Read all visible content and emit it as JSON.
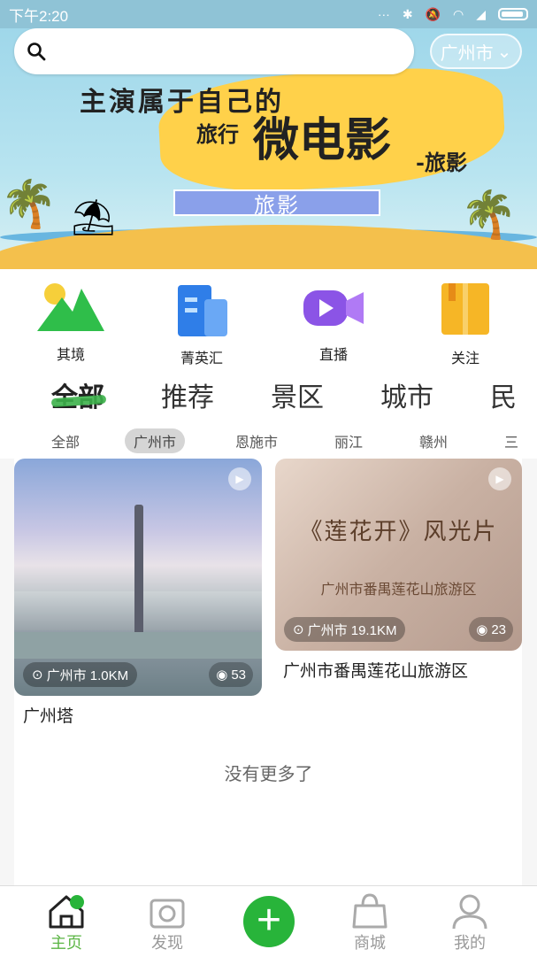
{
  "status_bar": {
    "time": "下午2:20",
    "icons": [
      "signal-dots-icon",
      "bluetooth-icon",
      "mute-icon",
      "wifi-icon",
      "signal-icon",
      "battery-icon"
    ]
  },
  "search": {
    "placeholder": "",
    "value": ""
  },
  "city_selector": {
    "label": "广州市"
  },
  "banner": {
    "line1": "主演属于自己的",
    "line2": "旅行",
    "line3": "微电影",
    "line4": "-旅影",
    "tag": "旅影"
  },
  "quick_entries": [
    {
      "label": "其境",
      "icon": "mountain-icon",
      "color": "#2fbe4a"
    },
    {
      "label": "菁英汇",
      "icon": "buildings-icon",
      "color": "#2f7ee8"
    },
    {
      "label": "直播",
      "icon": "video-camera-icon",
      "color": "#8b54e6"
    },
    {
      "label": "关注",
      "icon": "book-icon",
      "color": "#f6b626"
    }
  ],
  "tabs": [
    "全部",
    "推荐",
    "景区",
    "城市",
    "民"
  ],
  "active_tab": "全部",
  "sub_tabs": [
    "全部",
    "广州市",
    "恩施市",
    "丽江",
    "赣州",
    "三"
  ],
  "active_sub_tab": "广州市",
  "cards": [
    {
      "name": "广州塔",
      "location": "广州市 1.0KM",
      "views": "53"
    },
    {
      "name": "广州市番禺莲花山旅游区",
      "location": "广州市 19.1KM",
      "views": "23",
      "overlay_title": "《莲花开》风光片",
      "overlay_subtitle": "广州市番禺莲花山旅游区"
    }
  ],
  "no_more_text": "没有更多了",
  "bottom_nav": [
    {
      "label": "主页",
      "icon": "home-icon"
    },
    {
      "label": "发现",
      "icon": "camera-icon"
    },
    {
      "label": "",
      "icon": "plus-icon"
    },
    {
      "label": "商城",
      "icon": "shopping-bag-icon"
    },
    {
      "label": "我的",
      "icon": "user-icon"
    }
  ],
  "accent_color": "#5bb544"
}
